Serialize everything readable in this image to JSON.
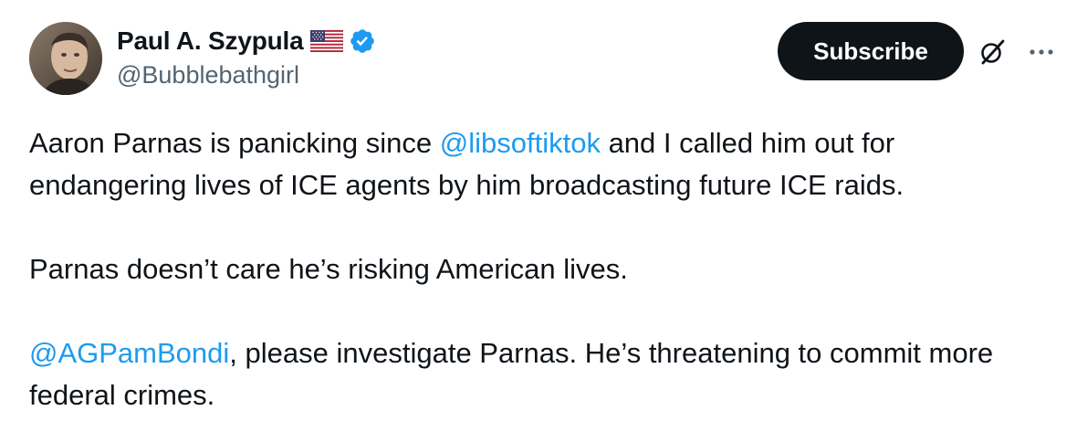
{
  "author": {
    "display_name": "Paul A. Szypula",
    "handle": "@Bubblebathgirl",
    "flag_icon": "us-flag-icon",
    "verified_icon": "verified-badge-icon",
    "verified_color": "#1d9bf0"
  },
  "actions": {
    "subscribe_label": "Subscribe",
    "grok_icon": "grok-icon",
    "more_icon": "more-options-icon"
  },
  "tweet": {
    "p1": {
      "before": "Aaron Parnas is panicking since ",
      "mention": "@libsoftiktok",
      "after": " and I called him out for endangering lives of ICE agents by him broadcasting future ICE raids."
    },
    "p2": "Parnas doesn’t care he’s risking American lives.",
    "p3": {
      "mention": "@AGPamBondi",
      "after": ", please investigate Parnas. He’s threatening to commit more federal crimes."
    }
  },
  "colors": {
    "text": "#0f1419",
    "secondary": "#536471",
    "link": "#1d9bf0",
    "button_bg": "#0f1419"
  }
}
